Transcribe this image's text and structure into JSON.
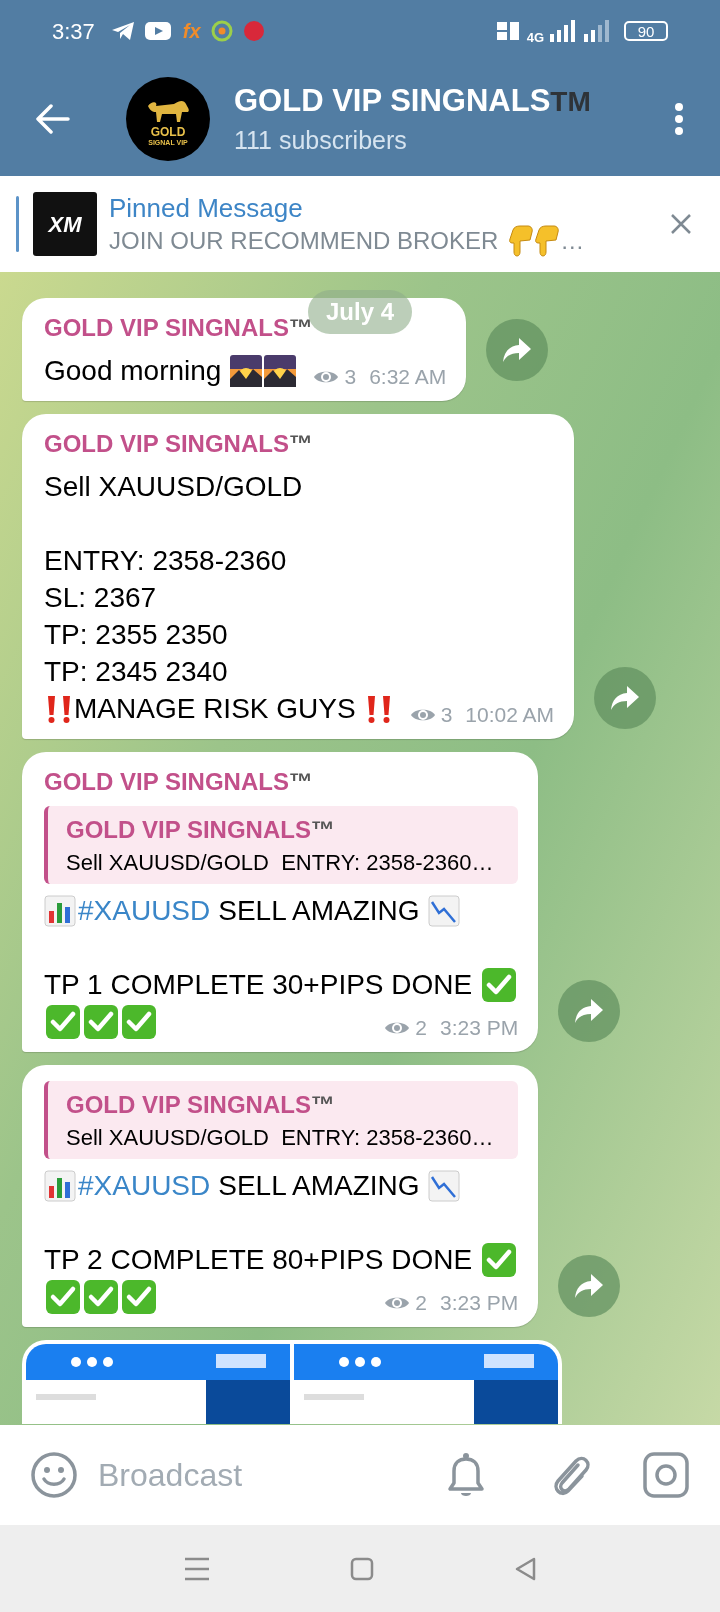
{
  "status_bar": {
    "time": "3:37",
    "app_label": "fx",
    "network": "4G",
    "battery": "90"
  },
  "header": {
    "title": "GOLD VIP SINGNALS",
    "title_mark": "TM",
    "subtitle": "111 subscribers",
    "avatar": {
      "line_1": "GOLD",
      "line_2": "SIGNAL VIP"
    }
  },
  "pinned": {
    "title": "Pinned Message",
    "text": "JOIN OUR RECOMMEND BROKER",
    "ellipsis": "…",
    "thumbnail_text": "XM"
  },
  "date_chip": "July 4",
  "messages": [
    {
      "kind": "text",
      "author": "GOLD VIP SINGNALS",
      "author_mark": "™",
      "lines": [
        {
          "kind": "line",
          "parts": [
            {
              "kind": "text",
              "text": "Good morning"
            },
            {
              "kind": "sunrise"
            },
            {
              "kind": "sunrise"
            }
          ]
        }
      ],
      "views": "3",
      "time": "6:32 AM"
    },
    {
      "kind": "text",
      "author": "GOLD VIP SINGNALS",
      "author_mark": "™",
      "lines": [
        {
          "kind": "line",
          "parts": [
            {
              "kind": "text",
              "text": "Sell XAUUSD/GOLD"
            }
          ]
        },
        {
          "kind": "blank"
        },
        {
          "kind": "line",
          "parts": [
            {
              "kind": "text",
              "text": "ENTRY: 2358-2360"
            }
          ]
        },
        {
          "kind": "line",
          "parts": [
            {
              "kind": "text",
              "text": "SL: 2367"
            }
          ]
        },
        {
          "kind": "line",
          "parts": [
            {
              "kind": "text",
              "text": "TP: 2355 2350"
            }
          ]
        },
        {
          "kind": "line",
          "parts": [
            {
              "kind": "text",
              "text": "TP: 2345 2340"
            }
          ]
        },
        {
          "kind": "line",
          "parts": [
            {
              "kind": "alert"
            },
            {
              "kind": "text",
              "text": "MANAGE RISK GUYS"
            },
            {
              "kind": "alert"
            }
          ]
        }
      ],
      "views": "3",
      "time": "10:02 AM"
    },
    {
      "kind": "text",
      "author": "GOLD VIP SINGNALS",
      "author_mark": "™",
      "quote": {
        "author": "GOLD VIP SINGNALS",
        "author_mark": "™",
        "text": "Sell XAUUSD/GOLD  ENTRY: 2358-2360…"
      },
      "lines": [
        {
          "kind": "line",
          "parts": [
            {
              "kind": "bars"
            },
            {
              "kind": "hashtag",
              "text": "#XAUUSD"
            },
            {
              "kind": "text",
              "text": "SELL AMAZING"
            },
            {
              "kind": "trend"
            }
          ]
        },
        {
          "kind": "blank"
        },
        {
          "kind": "line",
          "parts": [
            {
              "kind": "text",
              "text": "TP 1 COMPLETE 30+PIPS DONE"
            },
            {
              "kind": "check"
            }
          ]
        },
        {
          "kind": "line",
          "parts": [
            {
              "kind": "check"
            },
            {
              "kind": "check"
            },
            {
              "kind": "check"
            }
          ]
        }
      ],
      "views": "2",
      "time": "3:23 PM"
    },
    {
      "kind": "text",
      "quote": {
        "author": "GOLD VIP SINGNALS",
        "author_mark": "™",
        "text": "Sell XAUUSD/GOLD  ENTRY: 2358-2360…"
      },
      "lines": [
        {
          "kind": "line",
          "parts": [
            {
              "kind": "bars"
            },
            {
              "kind": "hashtag",
              "text": "#XAUUSD"
            },
            {
              "kind": "text",
              "text": "SELL AMAZING"
            },
            {
              "kind": "trend"
            }
          ]
        },
        {
          "kind": "blank"
        },
        {
          "kind": "line",
          "parts": [
            {
              "kind": "text",
              "text": "TP 2 COMPLETE 80+PIPS DONE"
            },
            {
              "kind": "check"
            }
          ]
        },
        {
          "kind": "line",
          "parts": [
            {
              "kind": "check"
            },
            {
              "kind": "check"
            },
            {
              "kind": "check"
            }
          ]
        }
      ],
      "views": "2",
      "time": "3:23 PM"
    },
    {
      "kind": "photos"
    }
  ],
  "composer": {
    "placeholder": "Broadcast"
  }
}
